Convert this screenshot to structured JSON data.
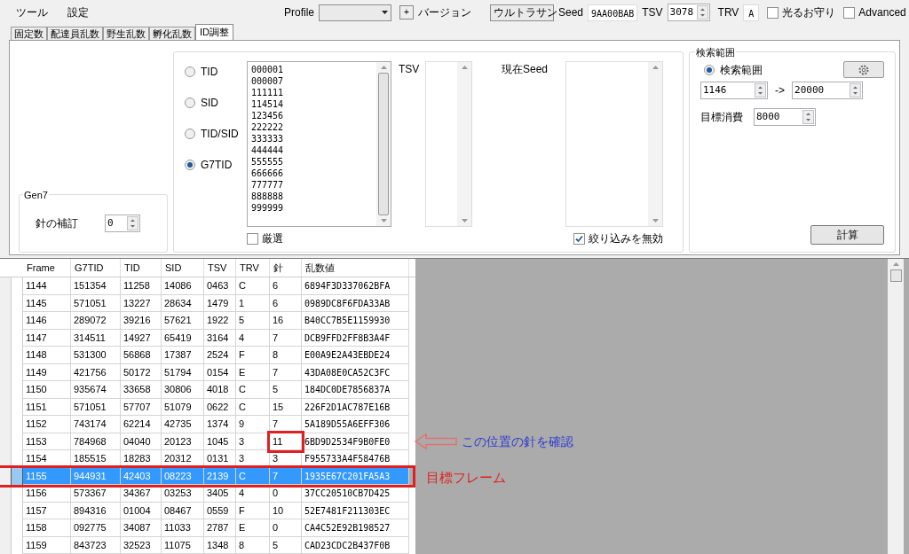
{
  "menu": [
    "ツール",
    "設定"
  ],
  "toolbar": {
    "profile_label": "Profile",
    "add_button": "+",
    "version_label": "バージョン",
    "version_value": "ウルトラサン",
    "seed_label": "Seed",
    "seed_value": "9AA00BAB",
    "tsv_label": "TSV",
    "tsv_value": "3078",
    "trv_label": "TRV",
    "trv_value": "A",
    "checkboxes": [
      {
        "label": "光るお守り",
        "checked": false
      },
      {
        "label": "Advanced",
        "checked": false
      }
    ]
  },
  "tabs": [
    {
      "label": "固定数",
      "selected": false
    },
    {
      "label": "配達員乱数",
      "selected": false
    },
    {
      "label": "野生乱数",
      "selected": false
    },
    {
      "label": "孵化乱数",
      "selected": false
    },
    {
      "label": "ID調整",
      "selected": true
    }
  ],
  "gen7": {
    "title": "Gen7",
    "label": "針の補訂",
    "value": "0"
  },
  "filter": {
    "radios": [
      {
        "label": "TID",
        "selected": false
      },
      {
        "label": "SID",
        "selected": false
      },
      {
        "label": "TID/SID",
        "selected": false
      },
      {
        "label": "G7TID",
        "selected": true
      }
    ],
    "id_list": [
      "000001",
      "000007",
      "111111",
      "114514",
      "123456",
      "222222",
      "333333",
      "444444",
      "555555",
      "666666",
      "777777",
      "888888",
      "999999"
    ],
    "exact_checkbox": {
      "label": "厳選",
      "checked": false
    },
    "tsv_label": "TSV",
    "seed_label": "現在Seed",
    "disable_checkbox": {
      "label": "絞り込みを無効",
      "checked": true
    }
  },
  "search": {
    "title": "検索範囲",
    "radio": {
      "label": "検索範囲",
      "selected": true
    },
    "from": "1146",
    "arrow": "->",
    "to": "20000",
    "target_label": "目標消費",
    "target_value": "8000",
    "calc_button": "計算"
  },
  "table": {
    "columns": [
      "Frame",
      "G7TID",
      "TID",
      "SID",
      "TSV",
      "TRV",
      "針",
      "乱数値"
    ],
    "rows": [
      {
        "cells": [
          "1144",
          "151354",
          "11258",
          "14086",
          "0463",
          "C",
          "6",
          "6894F3D337062BFA"
        ],
        "selected": false,
        "needle_marked": false,
        "row_marked": false
      },
      {
        "cells": [
          "1145",
          "571051",
          "13227",
          "28634",
          "1479",
          "1",
          "6",
          "0989DC8F6FDA33AB"
        ],
        "selected": false,
        "needle_marked": false,
        "row_marked": false
      },
      {
        "cells": [
          "1146",
          "289072",
          "39216",
          "57621",
          "1922",
          "5",
          "16",
          "B40CC7B5E1159930"
        ],
        "selected": false,
        "needle_marked": false,
        "row_marked": false
      },
      {
        "cells": [
          "1147",
          "314511",
          "14927",
          "65419",
          "3164",
          "4",
          "7",
          "DCB9FFD2FF8B3A4F"
        ],
        "selected": false,
        "needle_marked": false,
        "row_marked": false
      },
      {
        "cells": [
          "1148",
          "531300",
          "56868",
          "17387",
          "2524",
          "F",
          "8",
          "E00A9E2A43EBDE24"
        ],
        "selected": false,
        "needle_marked": false,
        "row_marked": false
      },
      {
        "cells": [
          "1149",
          "421756",
          "50172",
          "51794",
          "0154",
          "E",
          "7",
          "43DA08E0CA52C3FC"
        ],
        "selected": false,
        "needle_marked": false,
        "row_marked": false
      },
      {
        "cells": [
          "1150",
          "935674",
          "33658",
          "30806",
          "4018",
          "C",
          "5",
          "184DC0DE7856837A"
        ],
        "selected": false,
        "needle_marked": false,
        "row_marked": false
      },
      {
        "cells": [
          "1151",
          "571051",
          "57707",
          "51079",
          "0622",
          "C",
          "15",
          "226F2D1AC787E16B"
        ],
        "selected": false,
        "needle_marked": false,
        "row_marked": false
      },
      {
        "cells": [
          "1152",
          "743174",
          "62214",
          "42735",
          "1374",
          "9",
          "7",
          "5A189D55A6EFF306"
        ],
        "selected": false,
        "needle_marked": false,
        "row_marked": false
      },
      {
        "cells": [
          "1153",
          "784968",
          "04040",
          "20123",
          "1045",
          "3",
          "11",
          "6BD9D2534F9B0FE0"
        ],
        "selected": false,
        "needle_marked": true,
        "row_marked": false
      },
      {
        "cells": [
          "1154",
          "185515",
          "18283",
          "20312",
          "0131",
          "3",
          "3",
          "F955733A4F58476B"
        ],
        "selected": false,
        "needle_marked": false,
        "row_marked": false
      },
      {
        "cells": [
          "1155",
          "944931",
          "42403",
          "08223",
          "2139",
          "C",
          "7",
          "1935E67C201FA5A3"
        ],
        "selected": true,
        "needle_marked": false,
        "row_marked": true
      },
      {
        "cells": [
          "1156",
          "573367",
          "34367",
          "03253",
          "3405",
          "4",
          "0",
          "37CC20510CB7D425"
        ],
        "selected": false,
        "needle_marked": false,
        "row_marked": false
      },
      {
        "cells": [
          "1157",
          "894316",
          "01004",
          "08467",
          "0559",
          "F",
          "10",
          "52E7481F211303EC"
        ],
        "selected": false,
        "needle_marked": false,
        "row_marked": false
      },
      {
        "cells": [
          "1158",
          "092775",
          "34087",
          "11033",
          "2787",
          "E",
          "0",
          "CA4C52E92B198527"
        ],
        "selected": false,
        "needle_marked": false,
        "row_marked": false
      },
      {
        "cells": [
          "1159",
          "843723",
          "32523",
          "11075",
          "1348",
          "8",
          "5",
          "CAD23CDC2B437F0B"
        ],
        "selected": false,
        "needle_marked": false,
        "row_marked": false
      }
    ]
  },
  "annotations": {
    "needle_note": "この位置の針を確認",
    "row_note": "目標フレーム"
  }
}
